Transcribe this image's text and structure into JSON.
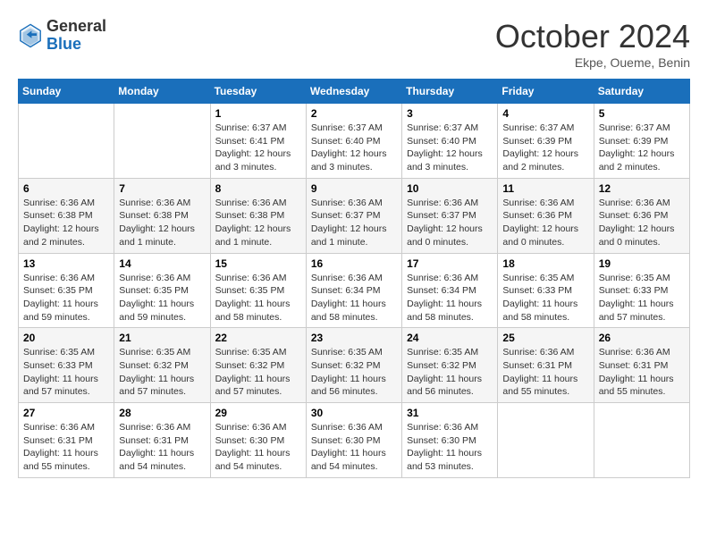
{
  "header": {
    "logo_general": "General",
    "logo_blue": "Blue",
    "title": "October 2024",
    "location": "Ekpe, Oueme, Benin"
  },
  "weekdays": [
    "Sunday",
    "Monday",
    "Tuesday",
    "Wednesday",
    "Thursday",
    "Friday",
    "Saturday"
  ],
  "weeks": [
    [
      {
        "day": "",
        "info": ""
      },
      {
        "day": "",
        "info": ""
      },
      {
        "day": "1",
        "info": "Sunrise: 6:37 AM\nSunset: 6:41 PM\nDaylight: 12 hours and 3 minutes."
      },
      {
        "day": "2",
        "info": "Sunrise: 6:37 AM\nSunset: 6:40 PM\nDaylight: 12 hours and 3 minutes."
      },
      {
        "day": "3",
        "info": "Sunrise: 6:37 AM\nSunset: 6:40 PM\nDaylight: 12 hours and 3 minutes."
      },
      {
        "day": "4",
        "info": "Sunrise: 6:37 AM\nSunset: 6:39 PM\nDaylight: 12 hours and 2 minutes."
      },
      {
        "day": "5",
        "info": "Sunrise: 6:37 AM\nSunset: 6:39 PM\nDaylight: 12 hours and 2 minutes."
      }
    ],
    [
      {
        "day": "6",
        "info": "Sunrise: 6:36 AM\nSunset: 6:38 PM\nDaylight: 12 hours and 2 minutes."
      },
      {
        "day": "7",
        "info": "Sunrise: 6:36 AM\nSunset: 6:38 PM\nDaylight: 12 hours and 1 minute."
      },
      {
        "day": "8",
        "info": "Sunrise: 6:36 AM\nSunset: 6:38 PM\nDaylight: 12 hours and 1 minute."
      },
      {
        "day": "9",
        "info": "Sunrise: 6:36 AM\nSunset: 6:37 PM\nDaylight: 12 hours and 1 minute."
      },
      {
        "day": "10",
        "info": "Sunrise: 6:36 AM\nSunset: 6:37 PM\nDaylight: 12 hours and 0 minutes."
      },
      {
        "day": "11",
        "info": "Sunrise: 6:36 AM\nSunset: 6:36 PM\nDaylight: 12 hours and 0 minutes."
      },
      {
        "day": "12",
        "info": "Sunrise: 6:36 AM\nSunset: 6:36 PM\nDaylight: 12 hours and 0 minutes."
      }
    ],
    [
      {
        "day": "13",
        "info": "Sunrise: 6:36 AM\nSunset: 6:35 PM\nDaylight: 11 hours and 59 minutes."
      },
      {
        "day": "14",
        "info": "Sunrise: 6:36 AM\nSunset: 6:35 PM\nDaylight: 11 hours and 59 minutes."
      },
      {
        "day": "15",
        "info": "Sunrise: 6:36 AM\nSunset: 6:35 PM\nDaylight: 11 hours and 58 minutes."
      },
      {
        "day": "16",
        "info": "Sunrise: 6:36 AM\nSunset: 6:34 PM\nDaylight: 11 hours and 58 minutes."
      },
      {
        "day": "17",
        "info": "Sunrise: 6:36 AM\nSunset: 6:34 PM\nDaylight: 11 hours and 58 minutes."
      },
      {
        "day": "18",
        "info": "Sunrise: 6:35 AM\nSunset: 6:33 PM\nDaylight: 11 hours and 58 minutes."
      },
      {
        "day": "19",
        "info": "Sunrise: 6:35 AM\nSunset: 6:33 PM\nDaylight: 11 hours and 57 minutes."
      }
    ],
    [
      {
        "day": "20",
        "info": "Sunrise: 6:35 AM\nSunset: 6:33 PM\nDaylight: 11 hours and 57 minutes."
      },
      {
        "day": "21",
        "info": "Sunrise: 6:35 AM\nSunset: 6:32 PM\nDaylight: 11 hours and 57 minutes."
      },
      {
        "day": "22",
        "info": "Sunrise: 6:35 AM\nSunset: 6:32 PM\nDaylight: 11 hours and 57 minutes."
      },
      {
        "day": "23",
        "info": "Sunrise: 6:35 AM\nSunset: 6:32 PM\nDaylight: 11 hours and 56 minutes."
      },
      {
        "day": "24",
        "info": "Sunrise: 6:35 AM\nSunset: 6:32 PM\nDaylight: 11 hours and 56 minutes."
      },
      {
        "day": "25",
        "info": "Sunrise: 6:36 AM\nSunset: 6:31 PM\nDaylight: 11 hours and 55 minutes."
      },
      {
        "day": "26",
        "info": "Sunrise: 6:36 AM\nSunset: 6:31 PM\nDaylight: 11 hours and 55 minutes."
      }
    ],
    [
      {
        "day": "27",
        "info": "Sunrise: 6:36 AM\nSunset: 6:31 PM\nDaylight: 11 hours and 55 minutes."
      },
      {
        "day": "28",
        "info": "Sunrise: 6:36 AM\nSunset: 6:31 PM\nDaylight: 11 hours and 54 minutes."
      },
      {
        "day": "29",
        "info": "Sunrise: 6:36 AM\nSunset: 6:30 PM\nDaylight: 11 hours and 54 minutes."
      },
      {
        "day": "30",
        "info": "Sunrise: 6:36 AM\nSunset: 6:30 PM\nDaylight: 11 hours and 54 minutes."
      },
      {
        "day": "31",
        "info": "Sunrise: 6:36 AM\nSunset: 6:30 PM\nDaylight: 11 hours and 53 minutes."
      },
      {
        "day": "",
        "info": ""
      },
      {
        "day": "",
        "info": ""
      }
    ]
  ]
}
